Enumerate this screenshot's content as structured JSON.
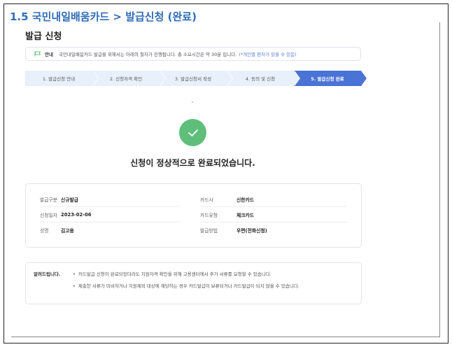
{
  "header": {
    "title": "1.5 국민내일배움카드 > 발급신청 (완료)"
  },
  "section": {
    "title": "발급 신청"
  },
  "notice": {
    "icon": "flag-icon",
    "label": "안내",
    "text": "국민내일배움카드 발급을 위해서는 아래의 절차가 진행됩니다. 총 소요시간은 약 30분 입니다.",
    "hint": "(*개인별 편차가 있을 수 있음)"
  },
  "steps": [
    {
      "label": "1. 발급신청 안내",
      "active": false
    },
    {
      "label": "2. 신청자격 확인",
      "active": false
    },
    {
      "label": "3. 발급신청서 작성",
      "active": false
    },
    {
      "label": "4. 동의 및 신청",
      "active": false
    },
    {
      "label": "5. 발급신청 완료",
      "active": true
    }
  ],
  "result": {
    "icon": "check-icon",
    "message": "신청이 정상적으로 완료되었습니다."
  },
  "info": {
    "left": [
      {
        "key": "발급구분",
        "value": "신규발급"
      },
      {
        "key": "신청일자",
        "value": "2023-02-06"
      },
      {
        "key": "성명",
        "value": "김고용"
      }
    ],
    "right": [
      {
        "key": "카드사",
        "value": "신한카드"
      },
      {
        "key": "카드유형",
        "value": "체크카드"
      },
      {
        "key": "발급방법",
        "value": "우편(전화신청)"
      }
    ]
  },
  "notes": {
    "title": "알려드립니다.",
    "items": [
      "카드발급 신청이 완료되었더라도 지원자격 확인을 위해 고용센터에서 추가 서류를 요청할 수 있습니다.",
      "제출한 서류가 미비하거나 지원제외 대상에 해당하는 경우 카드발급이 보류되거나 카드발급이 되지 않을 수 있습니다."
    ]
  },
  "colors": {
    "accent": "#4a73d6",
    "title": "#2f6bb5",
    "success": "#5fbf7a",
    "step_bg": "#e8f0fb"
  }
}
